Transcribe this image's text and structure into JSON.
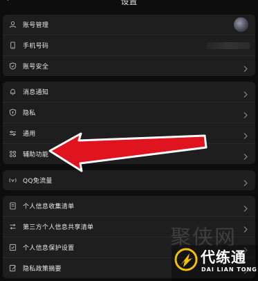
{
  "header": {
    "title": "设置",
    "back_icon": "chevron-left-icon"
  },
  "group1": {
    "items": [
      {
        "label": "账号管理",
        "icon": "user-icon",
        "right": "avatar"
      },
      {
        "label": "手机号码",
        "icon": "phone-icon",
        "right": "masked-number"
      },
      {
        "label": "账号安全",
        "icon": "shield-check-icon",
        "right": "chevron"
      }
    ]
  },
  "group2": {
    "items": [
      {
        "label": "消息通知",
        "icon": "bell-icon"
      },
      {
        "label": "隐私",
        "icon": "shield-lock-icon"
      },
      {
        "label": "通用",
        "icon": "sliders-icon"
      },
      {
        "label": "辅助功能",
        "icon": "accessibility-grid-icon"
      }
    ]
  },
  "group3": {
    "items": [
      {
        "label": "QQ免流量",
        "icon": "signal-icon"
      }
    ]
  },
  "group4": {
    "items": [
      {
        "label": "个人信息收集清单",
        "icon": "document-list-icon"
      },
      {
        "label": "第三方个人信息共享清单",
        "icon": "share-list-icon"
      },
      {
        "label": "个人信息保护设置",
        "icon": "checkbox-icon"
      },
      {
        "label": "隐私政策摘要",
        "icon": "edit-document-icon"
      }
    ]
  },
  "annotation": {
    "type": "red-arrow",
    "points_to": "辅助功能",
    "color": "#e0141e"
  },
  "watermark": {
    "text": "聚侠网",
    "badge_title": "代练通",
    "badge_subtitle": "DAI LIAN TONG",
    "accent": "#f2c200"
  }
}
